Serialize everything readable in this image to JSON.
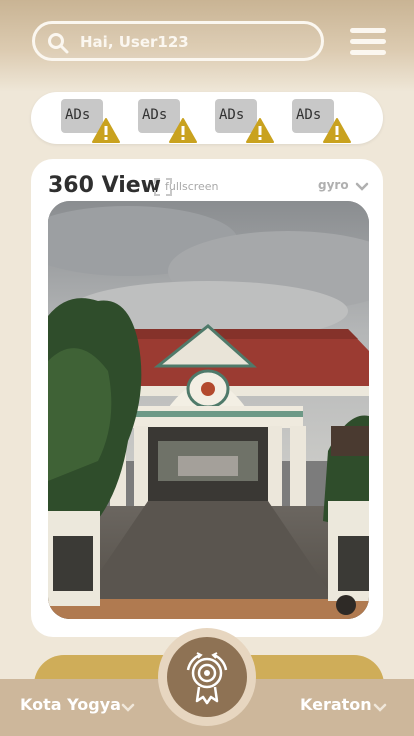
{
  "search": {
    "placeholder": "Hai, User123"
  },
  "ads": [
    {
      "label": "ADs"
    },
    {
      "label": "ADs"
    },
    {
      "label": "ADs"
    },
    {
      "label": "ADs"
    }
  ],
  "view360": {
    "title": "360 View",
    "fullscreen_label": "fullscreen",
    "mode_label": "gyro"
  },
  "footer": {
    "left_label": "Kota Yogya",
    "right_label": "Keraton"
  },
  "colors": {
    "accent_gold": "#cfad59",
    "footer": "#cdb79b",
    "center_button": "#8e7254",
    "background": "#efe7d8"
  }
}
